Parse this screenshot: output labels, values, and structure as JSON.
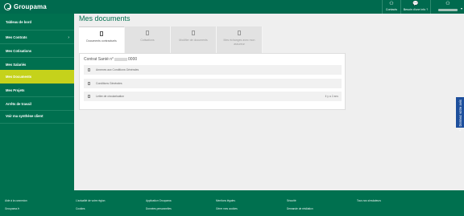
{
  "header": {
    "brand": "Groupama",
    "contacts_label": "Contacts",
    "info_label": "Besoin d'une info ?",
    "icons": [
      "groupama-logo-icon",
      "contacts-icon",
      "info-bubble-icon",
      "account-icon",
      "chevron-down-icon"
    ]
  },
  "sidebar": {
    "items": [
      {
        "label": "Tableau de bord"
      },
      {
        "label": "Mes Contrats",
        "chevron": "›"
      },
      {
        "label": "Mes Cotisations"
      },
      {
        "label": "Mes Salariés"
      },
      {
        "label": "Mes Documents"
      },
      {
        "label": "Mes Projets"
      },
      {
        "label": "Arrêts de travail"
      },
      {
        "label": "Voir ma synthèse client"
      }
    ],
    "active_color": "#c5d21b"
  },
  "main": {
    "title": "Mes documents",
    "tabs": [
      {
        "label": "Documents contractuels"
      },
      {
        "label": "Cotisations"
      },
      {
        "label": "Modifier de documents"
      },
      {
        "label": "Mes échanges avec mon assureur"
      }
    ],
    "contract_prefix": "Contrat Santé n°",
    "contract_suffix": "0000",
    "documents": [
      {
        "label": "Annexes aux Conditions Générales",
        "meta": ""
      },
      {
        "label": "Conditions Générales",
        "meta": ""
      },
      {
        "label": "Lettre de circularisation",
        "meta": "Il y a 2 ans"
      }
    ]
  },
  "quote_tab": {
    "label": "Donnez votre avis"
  },
  "footer": {
    "col1": [
      "Aide à la connexion",
      "Groupama.fr"
    ],
    "col2": [
      "L'actualité de votre région",
      "Cookies"
    ],
    "col3": [
      "Application Groupama",
      "Données personnelles"
    ],
    "col4": [
      "Mentions légales",
      "Gérer mes cookies"
    ],
    "col5": [
      "Sécurité",
      "Demande de résiliation"
    ],
    "col6": [
      "Tous nos simulateurs"
    ]
  },
  "colors": {
    "brand_green": "#006a4e",
    "sidebar_green": "#00704f",
    "active_lime": "#c5d21b",
    "quote_blue": "#1d4f9c"
  }
}
